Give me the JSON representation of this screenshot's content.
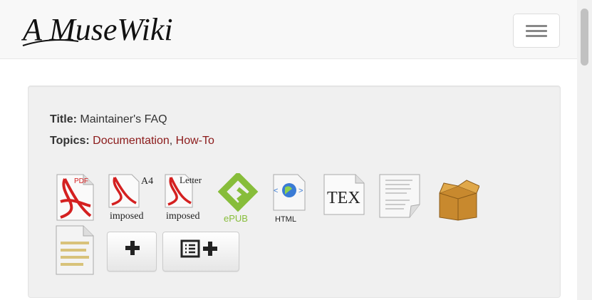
{
  "navbar": {
    "logo_text": "A MuseWiki",
    "menu_toggle_icon": "hamburger-icon"
  },
  "text": {
    "title_label": "Title:",
    "title_value": "Maintainer's FAQ",
    "topics_label": "Topics:",
    "topics": [
      "Documentation",
      "How-To"
    ],
    "topic_separator": ", "
  },
  "formats": {
    "pdf_label": "PDF",
    "a4_label": "A4",
    "a4_sub": "imposed",
    "letter_label": "Letter",
    "letter_sub": "imposed",
    "epub_label": "ePUB",
    "html_label": "HTML",
    "tex_label": "TEX"
  },
  "actions": {
    "add_icon": "plus-icon",
    "add_bookbuilder_icon": "list-plus-icon"
  },
  "colors": {
    "link": "#8b1a1a",
    "pdf_red": "#d42020",
    "epub_green": "#87bd3a",
    "box_brown": "#c8892e"
  }
}
